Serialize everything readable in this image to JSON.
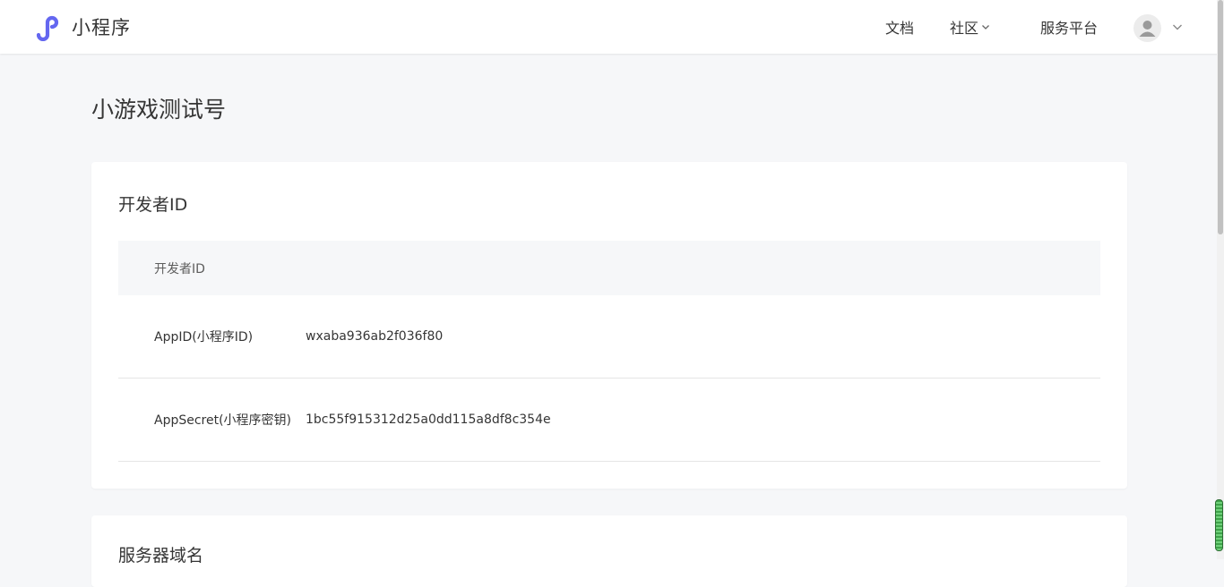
{
  "header": {
    "logo_text": "小程序",
    "nav": {
      "docs": "文档",
      "community": "社区",
      "service": "服务平台"
    },
    "brand_color": "#6467f0"
  },
  "page": {
    "title": "小游戏测试号"
  },
  "developer_card": {
    "title": "开发者ID",
    "table_header": "开发者ID",
    "rows": [
      {
        "label": "AppID(小程序ID)",
        "value": "wxaba936ab2f036f80"
      },
      {
        "label": "AppSecret(小程序密钥)",
        "value": "1bc55f915312d25a0dd115a8df8c354e"
      }
    ]
  },
  "server_card": {
    "title": "服务器域名"
  }
}
